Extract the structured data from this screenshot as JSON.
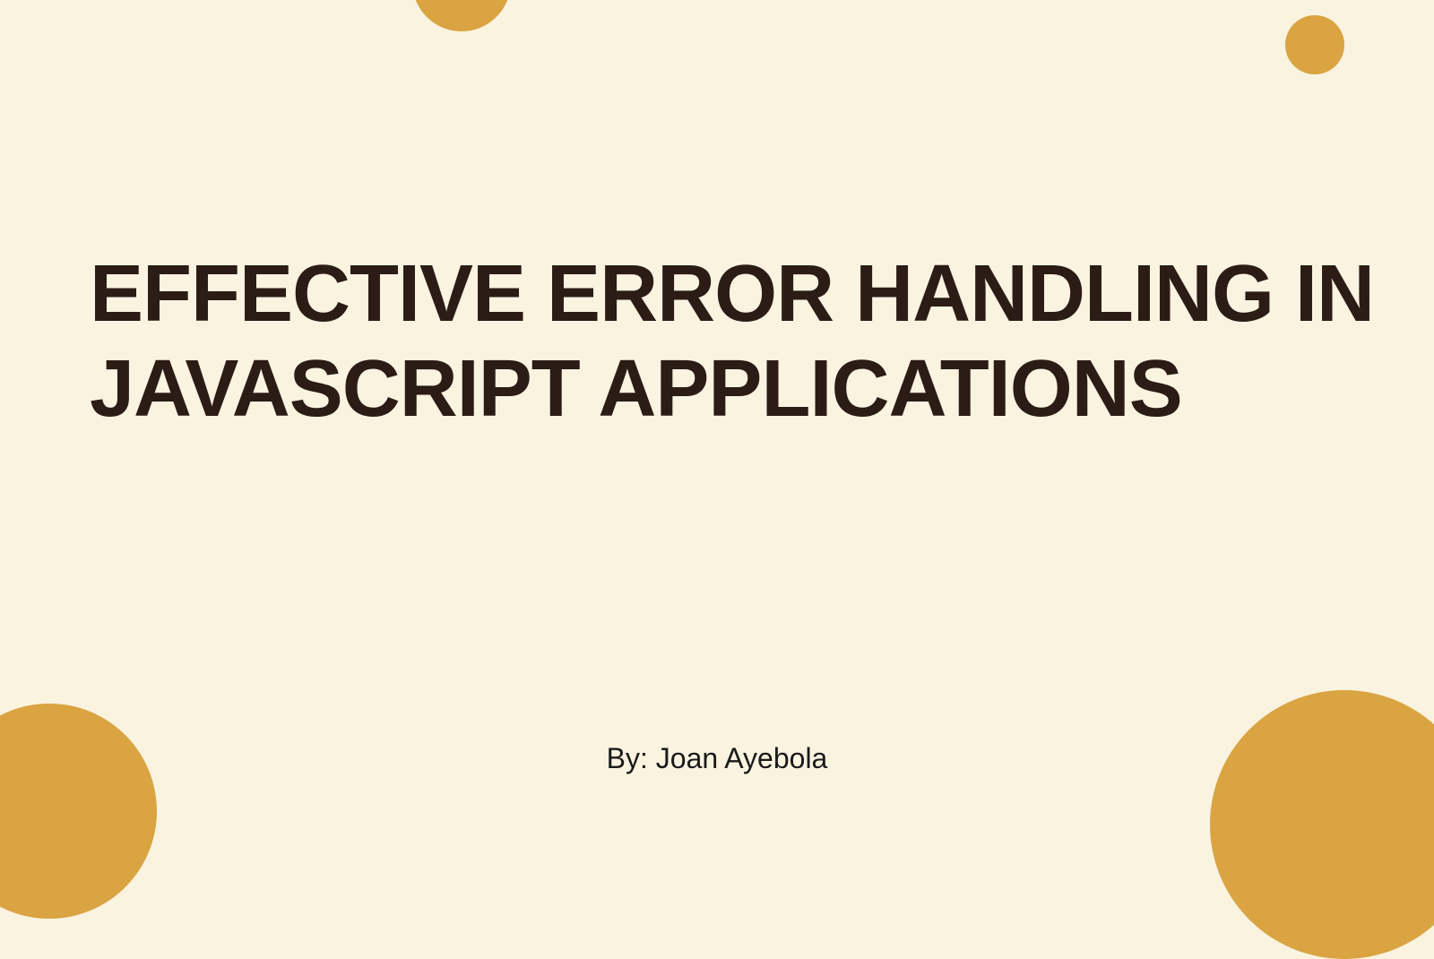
{
  "slide": {
    "title": "EFFECTIVE ERROR HANDLING IN JAVASCRIPT APPLICATIONS",
    "byline": "By: Joan Ayebola"
  },
  "colors": {
    "background": "#FAF3E0",
    "accent": "#D9A441",
    "text": "#2B1C15"
  }
}
